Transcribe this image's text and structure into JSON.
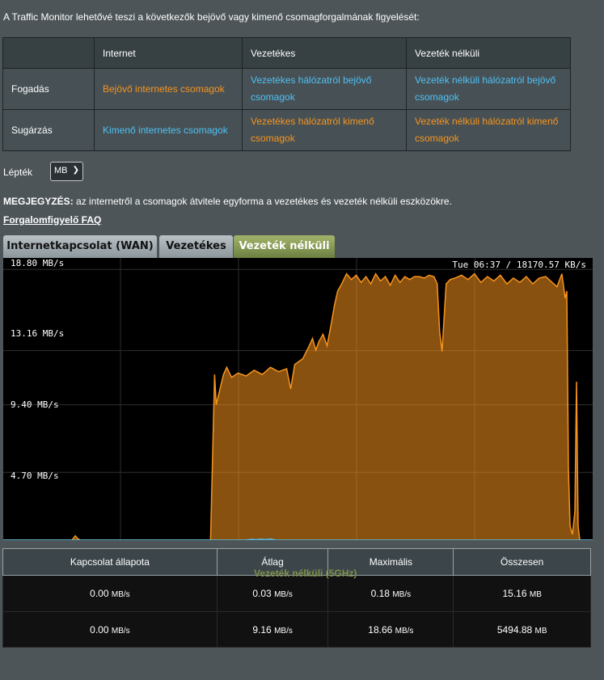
{
  "intro": "A Traffic Monitor lehetővé teszi a következők bejövő vagy kimenő csomagforgalmának figyelését:",
  "legend": {
    "headers": [
      "",
      "Internet",
      "Vezetékes",
      "Vezeték nélküli"
    ],
    "rows": [
      {
        "label": "Fogadás",
        "cells": [
          "Bejövő internetes csomagok",
          "Vezetékes hálózatról bejövő csomagok",
          "Vezeték nélküli hálózatról bejövő csomagok"
        ],
        "colors": [
          "#f7941d",
          "#4fc1f5",
          "#4fc1f5"
        ]
      },
      {
        "label": "Sugárzás",
        "cells": [
          "Kimenő internetes csomagok",
          "Vezetékes hálózatról kimenő csomagok",
          "Vezeték nélküli hálózatról kimenő csomagok"
        ],
        "colors": [
          "#4fc1f5",
          "#f7941d",
          "#f7941d"
        ]
      }
    ]
  },
  "scale": {
    "label": "Lépték",
    "selected": "MB"
  },
  "note": {
    "prefix": "MEGJEGYZÉS:",
    "text": " az internetről a csomagok átvitele egyforma a vezetékes és vezeték nélküli eszközökre."
  },
  "faq": "Forgalomfigyelő FAQ",
  "tabs": [
    {
      "label": "Internetkapcsolat (WAN)",
      "active": false
    },
    {
      "label": "Vezetékes",
      "active": false
    },
    {
      "label": "Vezeték nélküli",
      "active": true
    }
  ],
  "chart_data": {
    "type": "area",
    "readout": "Tue 06:37 / 18170.57 KB/s",
    "yticks": [
      "18.80 MB/s",
      "13.16 MB/s",
      "9.40 MB/s",
      "4.70 MB/s"
    ],
    "ytick_values": [
      18.8,
      13.16,
      9.4,
      4.7
    ],
    "ylim": [
      0,
      19.6
    ],
    "xlim": [
      0,
      728
    ],
    "grid": true,
    "series": [
      {
        "color": "#f7941d",
        "x": [
          0,
          85,
          89,
          92,
          95,
          256,
          261,
          263,
          272,
          276,
          282,
          290,
          300,
          310,
          320,
          330,
          340,
          350,
          355,
          360,
          370,
          378,
          382,
          386,
          390,
          395,
          400,
          405,
          409,
          413,
          418,
          424,
          430,
          436,
          442,
          448,
          454,
          460,
          466,
          472,
          478,
          484,
          490,
          496,
          502,
          508,
          514,
          520,
          526,
          532,
          536,
          539,
          542,
          547,
          552,
          558,
          566,
          574,
          582,
          590,
          598,
          606,
          614,
          622,
          630,
          638,
          646,
          654,
          662,
          670,
          678,
          684,
          690,
          694,
          696,
          698,
          700,
          703,
          706,
          708,
          710,
          712,
          728
        ],
        "y": [
          0,
          0,
          0.3,
          0.1,
          0,
          0,
          11.5,
          9.4,
          11.5,
          12,
          11.3,
          11.6,
          11.4,
          11.8,
          11.5,
          12,
          11.7,
          11.9,
          10.5,
          12.2,
          12.6,
          13.5,
          14,
          13.2,
          13.8,
          14.3,
          13.5,
          15,
          16.3,
          17.3,
          17.8,
          18.5,
          18.1,
          18.4,
          17.9,
          18.3,
          17.8,
          18.5,
          18,
          18.3,
          17.7,
          18.4,
          17.9,
          18.3,
          18.1,
          18.3,
          18.3,
          18.2,
          18.4,
          18.3,
          17.8,
          14.5,
          13.1,
          17.8,
          18.1,
          18.2,
          18.4,
          18.1,
          18.5,
          17.9,
          18.3,
          18,
          18.4,
          17.8,
          18.2,
          17.9,
          18.3,
          17.8,
          18.2,
          18.3,
          17.9,
          17.6,
          18.5,
          16.8,
          17.3,
          5,
          1,
          0.4,
          2,
          11,
          1,
          0,
          0
        ]
      },
      {
        "color": "#4fc1f5",
        "x": [
          0,
          300,
          306,
          312,
          318,
          324,
          330,
          336,
          728
        ],
        "y": [
          0,
          0,
          0.05,
          0.02,
          0.06,
          0.03,
          0.08,
          0,
          0
        ]
      }
    ]
  },
  "overlay_label": "Vezeték nélküli (5GHz)",
  "stats": {
    "headers": [
      "Kapcsolat állapota",
      "Átlag",
      "Maximális",
      "Összesen"
    ],
    "rows": [
      {
        "status": "0.00",
        "status_unit": "MB/s",
        "status_color": "#4fc1f5",
        "avg": "0.03",
        "avg_unit": "MB/s",
        "max": "0.18",
        "max_unit": "MB/s",
        "total": "15.16",
        "total_unit": "MB"
      },
      {
        "status": "0.00",
        "status_unit": "MB/s",
        "status_color": "#f7941d",
        "avg": "9.16",
        "avg_unit": "MB/s",
        "max": "18.66",
        "max_unit": "MB/s",
        "total": "5494.88",
        "total_unit": "MB"
      }
    ]
  }
}
